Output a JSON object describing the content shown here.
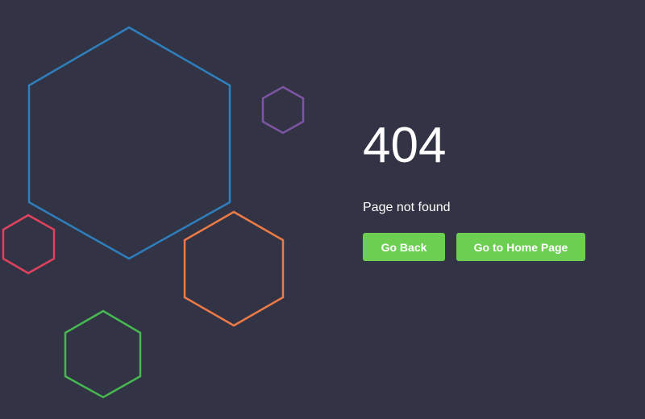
{
  "error": {
    "code": "404",
    "message": "Page not found"
  },
  "buttons": {
    "back_label": "Go Back",
    "home_label": "Go to Home Page"
  },
  "colors": {
    "background": "#323345",
    "text": "#ffffff",
    "button": "#6ccf52",
    "hex_blue": "#2f7fbd",
    "hex_purple": "#7e55a4",
    "hex_red": "#e0425e",
    "hex_orange": "#ee7a45",
    "hex_green": "#46b850"
  }
}
